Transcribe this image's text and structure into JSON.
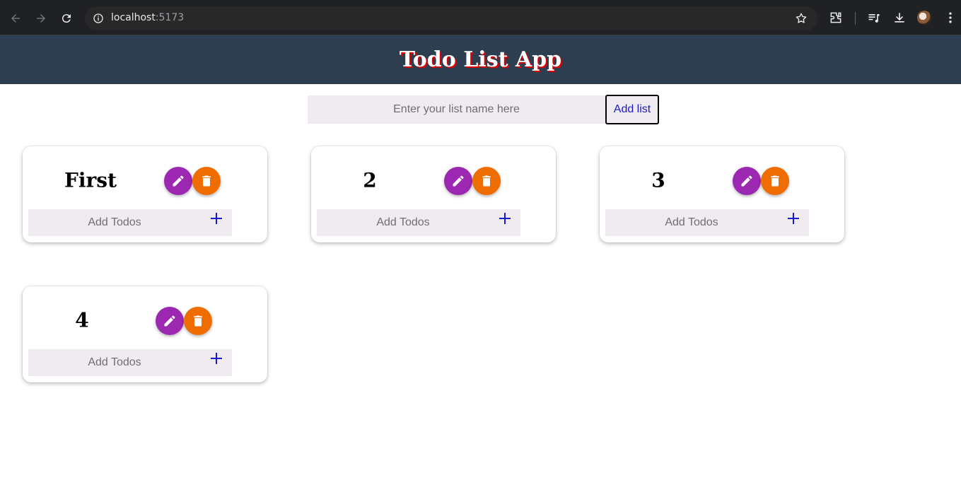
{
  "browser": {
    "url_host": "localhost",
    "url_port": ":5173",
    "icons": [
      "back-icon",
      "forward-icon",
      "reload-icon",
      "site-info-icon",
      "bookmark-star-icon",
      "extensions-icon",
      "media-control-icon",
      "downloads-icon",
      "profile-avatar",
      "more-menu-icon"
    ]
  },
  "app": {
    "title": "Todo List App"
  },
  "add_list": {
    "placeholder": "Enter your list name here",
    "value": "",
    "button_label": "Add list"
  },
  "lists": [
    {
      "name": "First",
      "todo_placeholder": "Add Todos",
      "edit_icon": "pencil-icon",
      "delete_icon": "trash-icon",
      "add_icon": "plus-icon"
    },
    {
      "name": "2",
      "todo_placeholder": "Add Todos",
      "edit_icon": "pencil-icon",
      "delete_icon": "trash-icon",
      "add_icon": "plus-icon"
    },
    {
      "name": "3",
      "todo_placeholder": "Add Todos",
      "edit_icon": "pencil-icon",
      "delete_icon": "trash-icon",
      "add_icon": "plus-icon"
    },
    {
      "name": "4",
      "todo_placeholder": "Add Todos",
      "edit_icon": "pencil-icon",
      "delete_icon": "trash-icon",
      "add_icon": "plus-icon"
    }
  ],
  "colors": {
    "header_bg": "#2c3e50",
    "title_shadow": "#e00000",
    "edit_button": "#9c27b0",
    "delete_button": "#ef6c00",
    "input_bg": "#f0ebf1",
    "add_icon": "#1a1acc"
  }
}
